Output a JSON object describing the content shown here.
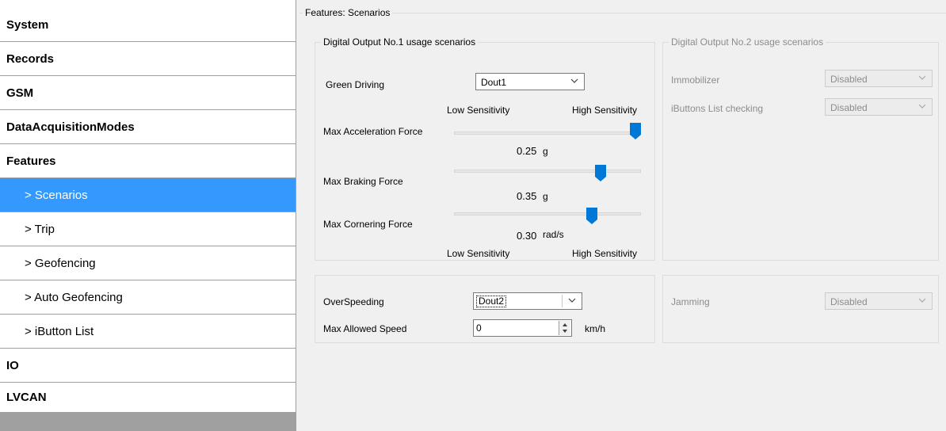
{
  "sidebar": {
    "items": [
      {
        "label": "System"
      },
      {
        "label": "Records"
      },
      {
        "label": "GSM"
      },
      {
        "label": "DataAcquisitionModes"
      },
      {
        "label": "Features"
      },
      {
        "label": "> Scenarios"
      },
      {
        "label": "> Trip"
      },
      {
        "label": "> Geofencing"
      },
      {
        "label": "> Auto Geofencing"
      },
      {
        "label": "> iButton List"
      },
      {
        "label": "IO"
      },
      {
        "label": "LVCAN"
      }
    ]
  },
  "main": {
    "title": "Features: Scenarios",
    "dout1": {
      "title": "Digital Output No.1 usage scenarios",
      "green_driving_label": "Green Driving",
      "green_driving_value": "Dout1",
      "low_sensitivity": "Low Sensitivity",
      "high_sensitivity": "High Sensitivity",
      "max_accel_label": "Max Acceleration Force",
      "max_accel_value": "0.25",
      "max_accel_unit": "g",
      "max_accel_level": 1.0,
      "max_braking_label": "Max Braking Force",
      "max_braking_value": "0.35",
      "max_braking_unit": "g",
      "max_braking_level": 0.8,
      "max_cornering_label": "Max Cornering Force",
      "max_cornering_value": "0.30",
      "max_cornering_unit": "rad/s",
      "max_cornering_level": 0.75
    },
    "dout2": {
      "title": "Digital Output No.2 usage scenarios",
      "immobilizer_label": "Immobilizer",
      "immobilizer_value": "Disabled",
      "ibuttons_label": "iButtons List checking",
      "ibuttons_value": "Disabled"
    },
    "overspeed": {
      "label": "OverSpeeding",
      "value": "Dout2",
      "max_speed_label": "Max Allowed Speed",
      "max_speed_value": "0",
      "max_speed_unit": "km/h"
    },
    "jamming": {
      "label": "Jamming",
      "value": "Disabled"
    }
  },
  "colors": {
    "selected": "#3399ff",
    "slider_thumb": "#0078d7"
  }
}
